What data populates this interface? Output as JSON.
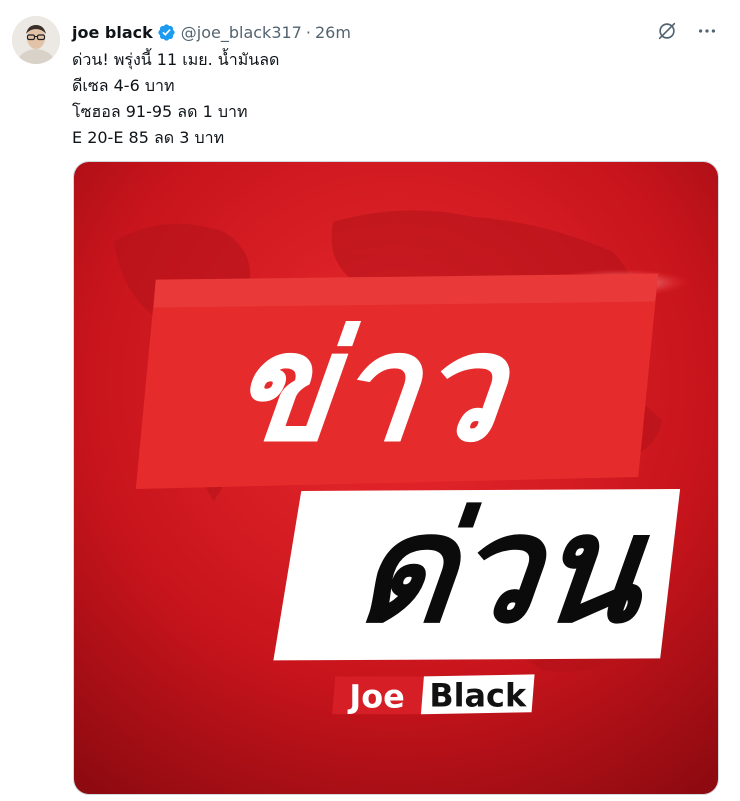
{
  "tweet": {
    "display_name": "joe black",
    "handle": "@joe_black317",
    "separator": "·",
    "time": "26m",
    "lines": [
      "ด่วน! พรุ่งนี้ 11 เมย. น้ำมันลด",
      "ดีเซล 4-6 บาท",
      "โซฮอล 91-95 ลด 1 บาท",
      "E 20-E 85 ลด 3 บาท"
    ],
    "icons": {
      "verified": "verified-badge-icon",
      "grok": "grok-icon",
      "more": "more-icon"
    }
  },
  "image": {
    "headline_top": "ข่าว",
    "headline_bottom": "ด่วน",
    "brand_joe": "Joe",
    "brand_black": "Black",
    "colors": {
      "background": "#d11a22",
      "banner_red": "#e52b2b",
      "banner_white": "#ffffff",
      "brand_red": "#d51e25",
      "verified_blue": "#1d9bf0"
    }
  }
}
